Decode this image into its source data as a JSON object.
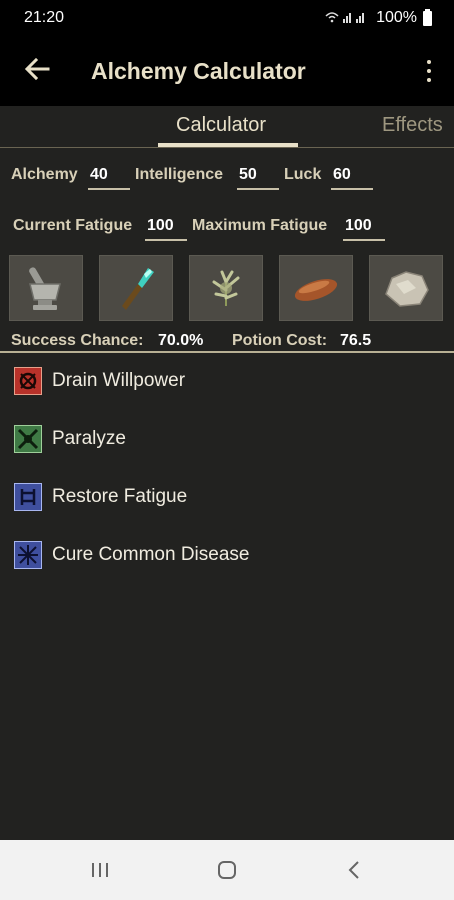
{
  "status": {
    "time": "21:20",
    "battery": "100%",
    "signal_icons": "wifi-icon signal-icon"
  },
  "appbar": {
    "title": "Alchemy Calculator"
  },
  "tabs": [
    {
      "label": "Calculator"
    },
    {
      "label": "Effects"
    }
  ],
  "attributes": {
    "alchemy": {
      "label": "Alchemy",
      "value": "40"
    },
    "intelligence": {
      "label": "Intelligence",
      "value": "50"
    },
    "luck": {
      "label": "Luck",
      "value": "60"
    },
    "current_fatigue": {
      "label": "Current Fatigue",
      "value": "100"
    },
    "maximum_fatigue": {
      "label": "Maximum Fatigue",
      "value": "100"
    }
  },
  "ingredients": [
    {
      "icon": "mortar-pestle-icon"
    },
    {
      "icon": "glowing-crystal-icon"
    },
    {
      "icon": "plant-sprig-icon"
    },
    {
      "icon": "bread-loaf-icon"
    },
    {
      "icon": "grey-rock-icon"
    }
  ],
  "stats": {
    "success_label": "Success Chance:",
    "success_value": "70.0%",
    "cost_label": "Potion Cost:",
    "cost_value": "76.5"
  },
  "effects": [
    {
      "label": "Drain Willpower",
      "icon": "drain-willpower-icon",
      "color": "#b8322a"
    },
    {
      "label": "Paralyze",
      "icon": "paralyze-icon",
      "color": "#3f7a45"
    },
    {
      "label": "Restore Fatigue",
      "icon": "restore-fatigue-icon",
      "color": "#3f4f9e"
    },
    {
      "label": "Cure Common Disease",
      "icon": "cure-disease-icon",
      "color": "#3f4f9e"
    }
  ],
  "colors": {
    "background": "#222220",
    "accent": "#e8e0c8",
    "nav_bar": "#f2f2f2"
  }
}
